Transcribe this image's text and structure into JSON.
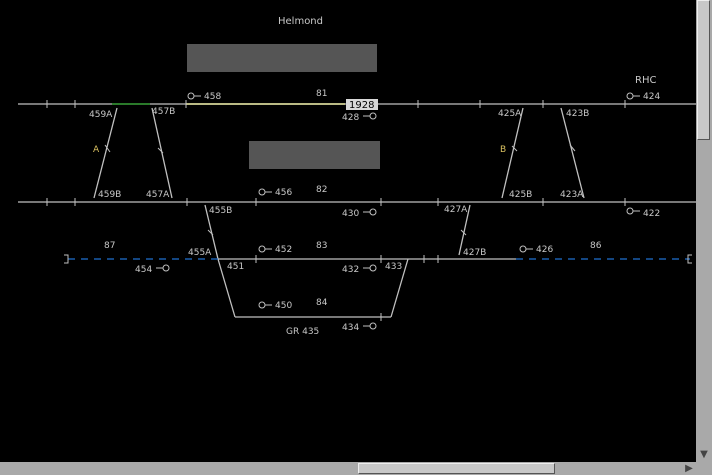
{
  "station": {
    "title": "Helmond",
    "rhc": "RHC",
    "group": "GR 435"
  },
  "colors": {
    "track": "#c0c0c0",
    "spare": "#1f6fd0",
    "occupied": "#e8e8a0",
    "panel": "#555555",
    "text": "#c8c8c8",
    "yellow": "#d8c060"
  },
  "signals": {
    "s458": "458",
    "s428": "428",
    "s424": "424",
    "s456": "456",
    "s430": "430",
    "s422": "422",
    "s452": "452",
    "s432": "432",
    "s426": "426",
    "s454": "454",
    "s450": "450",
    "s434": "434"
  },
  "switches": {
    "w459A": "459A",
    "w457B": "457B",
    "w459B": "459B",
    "w457A": "457A",
    "w425A": "425A",
    "w423B": "423B",
    "w425B": "425B",
    "w423A": "423A",
    "w455B": "455B",
    "w455A": "455A",
    "w451": "451",
    "w427A": "427A",
    "w427B": "427B",
    "w433": "433"
  },
  "tracks": {
    "t81": "81",
    "t82": "82",
    "t83": "83",
    "t84": "84",
    "t86": "86",
    "t87": "87"
  },
  "points": {
    "A": "A",
    "B": "B"
  },
  "train_number": "1928"
}
